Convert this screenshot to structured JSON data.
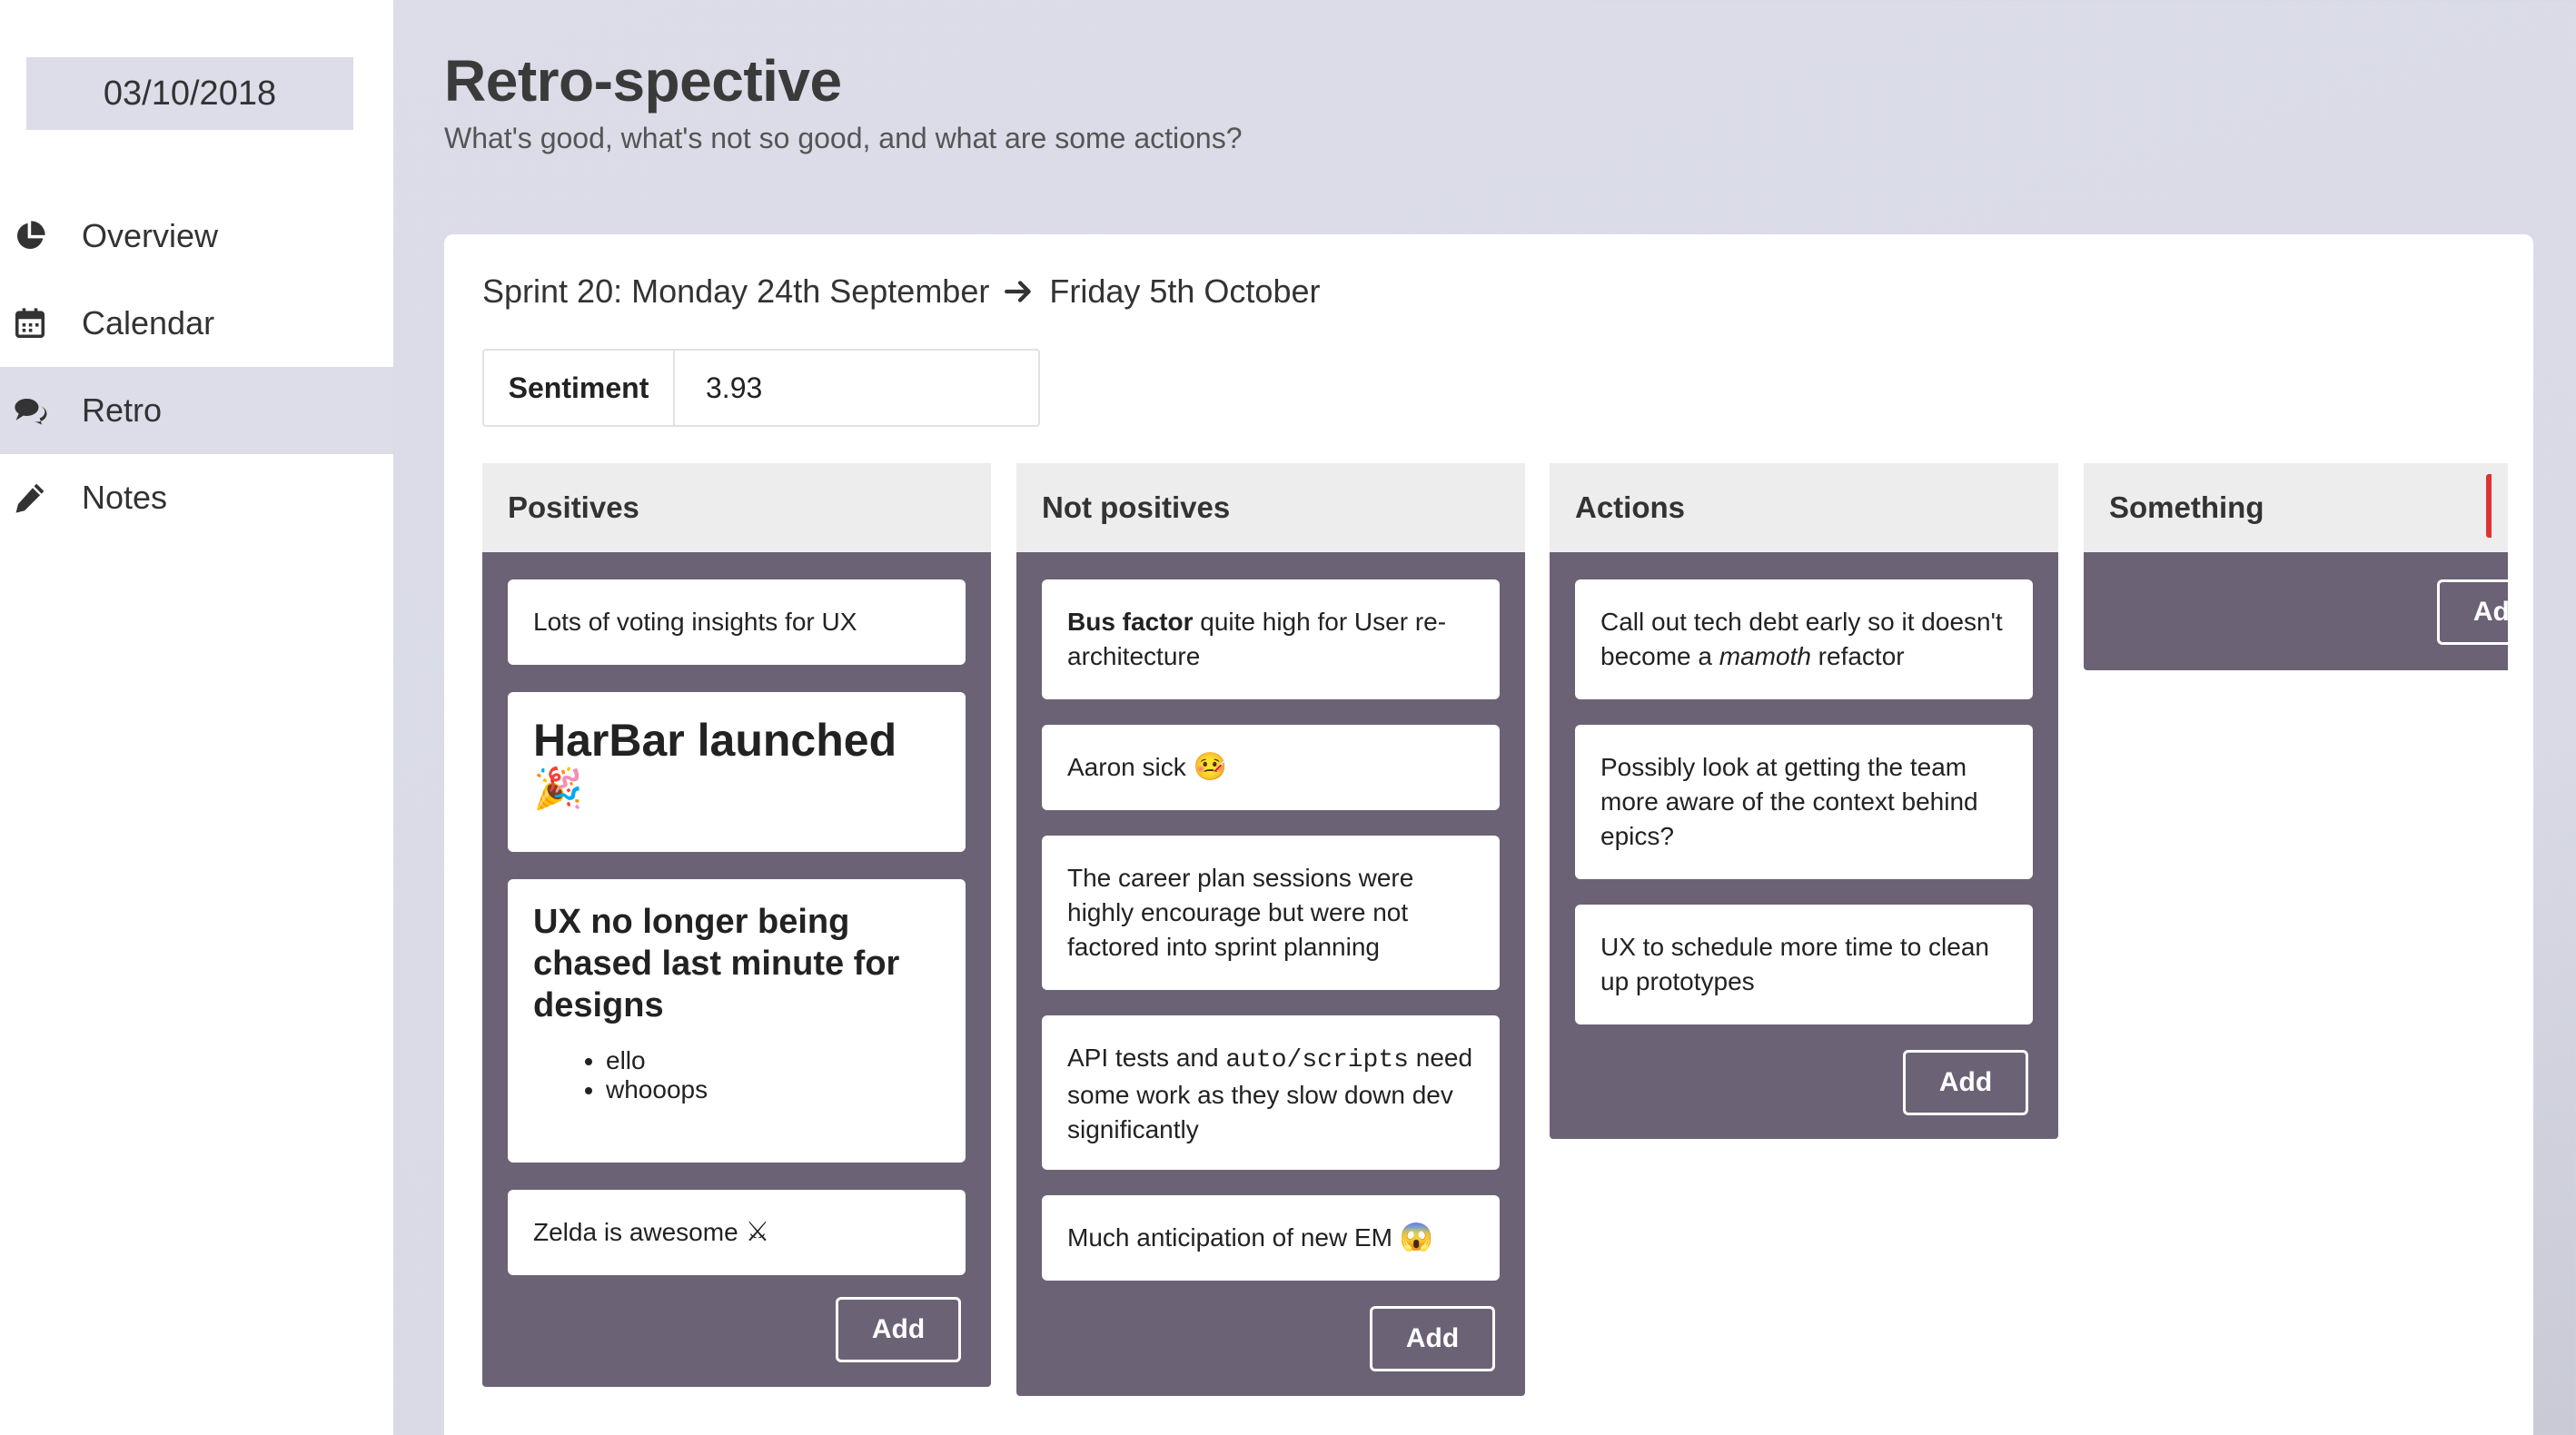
{
  "sidebar": {
    "date": "03/10/2018",
    "items": [
      {
        "label": "Overview",
        "icon": "pie-chart-icon"
      },
      {
        "label": "Calendar",
        "icon": "calendar-icon"
      },
      {
        "label": "Retro",
        "icon": "comments-icon",
        "active": true
      },
      {
        "label": "Notes",
        "icon": "pencil-icon"
      }
    ]
  },
  "header": {
    "title": "Retro-spective",
    "subtitle": "What's good, what's not so good, and what are some actions?"
  },
  "sprint": {
    "start": "Sprint 20: Monday 24th September",
    "end": "Friday 5th October"
  },
  "sentiment": {
    "label": "Sentiment",
    "value": "3.93"
  },
  "columns": {
    "positives": {
      "title": "Positives",
      "card1": "Lots of voting insights for UX",
      "card2_heading": "HarBar launched",
      "card2_emoji": "🎉",
      "card3_heading": "UX no longer being chased last minute for designs",
      "card3_list": [
        "ello",
        "whooops"
      ],
      "card4": "Zelda is awesome",
      "card4_emoji": "⚔",
      "add": "Add"
    },
    "not_positives": {
      "title": "Not positives",
      "card1_bold": "Bus factor",
      "card1_rest": " quite high for User re-architecture",
      "card2": "Aaron sick",
      "card2_emoji": "🤒",
      "card3": "The career plan sessions were highly encourage but were not factored into sprint planning",
      "card4_pre": "API tests and ",
      "card4_code": "auto/scripts",
      "card4_post": " need some work as they slow down dev significantly",
      "card5": "Much anticipation of new EM",
      "card5_emoji": "😱",
      "add": "Add"
    },
    "actions": {
      "title": "Actions",
      "card1_pre": "Call out tech debt early so it doesn't become a ",
      "card1_em": "mamoth",
      "card1_post": " refactor",
      "card2": "Possibly look at getting the team more aware of the context behind epics?",
      "card3": "UX to schedule more time to clean up prototypes",
      "add": "Add"
    },
    "something": {
      "title": "Something",
      "add": "Add"
    }
  },
  "colors": {
    "column_bg": "#6c6275",
    "header_bg": "#ededee",
    "page_bg": "#dcdde9"
  }
}
